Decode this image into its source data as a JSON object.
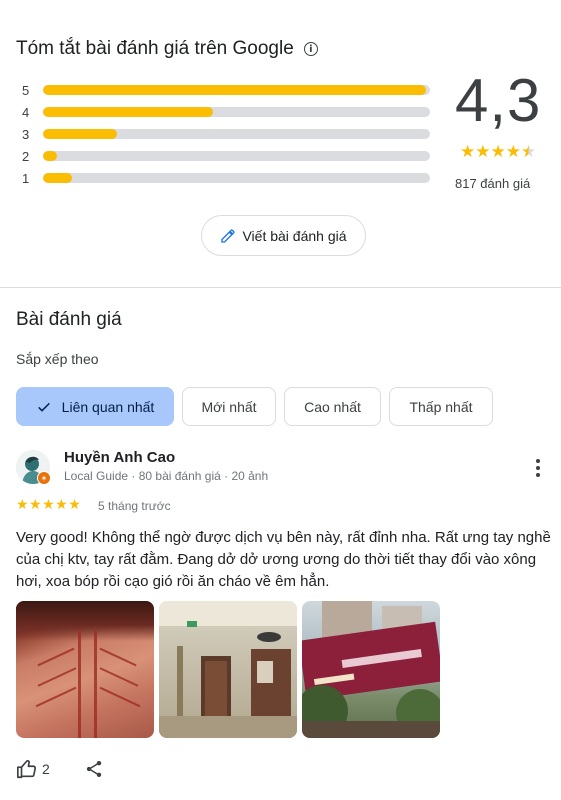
{
  "summary": {
    "title": "Tóm tắt bài đánh giá trên Google",
    "rating_bars": [
      {
        "label": "5",
        "fraction": 0.99
      },
      {
        "label": "4",
        "fraction": 0.44
      },
      {
        "label": "3",
        "fraction": 0.19
      },
      {
        "label": "2",
        "fraction": 0.035
      },
      {
        "label": "1",
        "fraction": 0.075
      }
    ],
    "score": "4,3",
    "stars": "★★★★",
    "half_star": "★",
    "review_count": "817 đánh giá",
    "write_review_label": "Viết bài đánh giá"
  },
  "reviews": {
    "title": "Bài đánh giá",
    "sort_label": "Sắp xếp theo",
    "sort_options": [
      {
        "label": "Liên quan nhất",
        "selected": true
      },
      {
        "label": "Mới nhất",
        "selected": false
      },
      {
        "label": "Cao nhất",
        "selected": false
      },
      {
        "label": "Thấp nhất",
        "selected": false
      }
    ],
    "items": [
      {
        "author": "Huyền Anh Cao",
        "meta": "Local Guide · 80 bài đánh giá · 20 ảnh",
        "stars": "★★★★★",
        "time": "5 tháng trước",
        "text": "Very good! Không thể ngờ được dịch vụ bên này, rất đỉnh nha. Rất ưng tay nghề của chị ktv, tay rất đằm. Đang dở dở ương ương do thời tiết thay đổi vào xông hơi, xoa bóp rồi cạo gió rồi ăn cháo về êm hẳn.",
        "photos": [
          "back-scraping-photo",
          "hallway-photo",
          "storefront-photo"
        ],
        "like_count": "2"
      }
    ]
  },
  "colors": {
    "star": "#fbbc04",
    "selected_chip": "#a8c7fa",
    "bar_track": "#dadce0"
  }
}
